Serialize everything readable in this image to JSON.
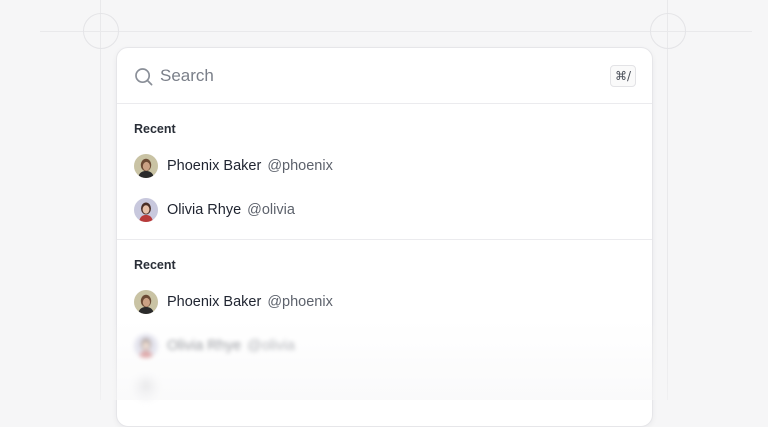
{
  "search": {
    "placeholder": "Search",
    "shortcut": "⌘/"
  },
  "sections": [
    {
      "heading": "Recent",
      "items": [
        {
          "name": "Phoenix Baker",
          "handle": "@phoenix",
          "avatar": "phoenix-avatar"
        },
        {
          "name": "Olivia Rhye",
          "handle": "@olivia",
          "avatar": "olivia-avatar"
        }
      ]
    },
    {
      "heading": "Recent",
      "items": [
        {
          "name": "Phoenix Baker",
          "handle": "@phoenix",
          "avatar": "phoenix-avatar"
        },
        {
          "name": "Olivia Rhye",
          "handle": "@olivia",
          "avatar": "olivia-avatar"
        },
        {
          "name": "",
          "handle": "",
          "avatar": "avatar"
        }
      ]
    }
  ],
  "colors": {
    "background": "#f6f6f7",
    "panel": "#ffffff",
    "border": "#e6e6e9",
    "text": "#1f2430",
    "muted": "#5d626c"
  }
}
